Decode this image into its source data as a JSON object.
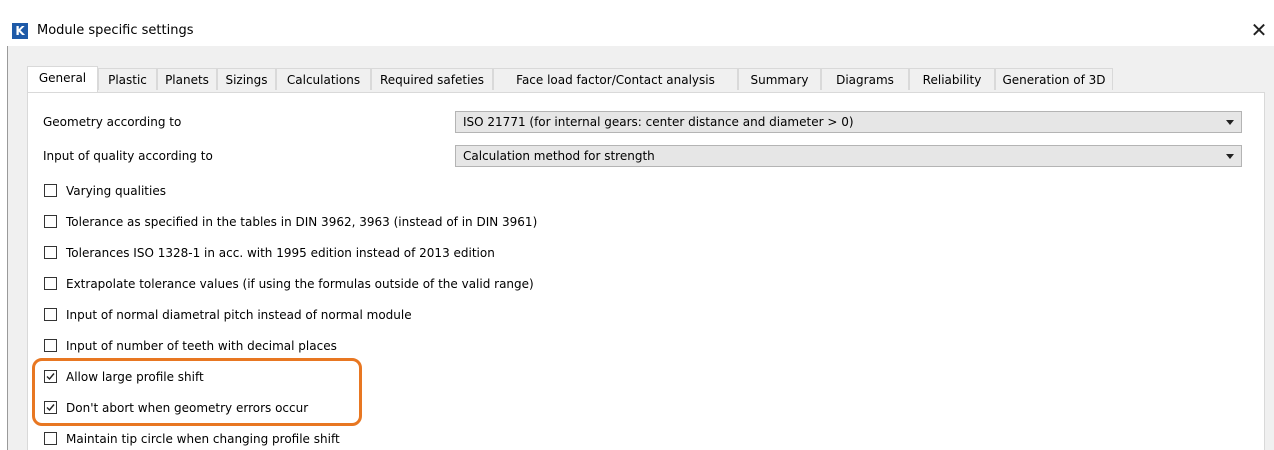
{
  "window": {
    "title": "Module specific settings",
    "app_icon_letter": "K",
    "close_glyph": "✕"
  },
  "tabs": [
    {
      "label": "General",
      "active": true
    },
    {
      "label": "Plastic",
      "active": false
    },
    {
      "label": "Planets",
      "active": false
    },
    {
      "label": "Sizings",
      "active": false
    },
    {
      "label": "Calculations",
      "active": false
    },
    {
      "label": "Required safeties",
      "active": false
    },
    {
      "label": "Face load factor/Contact analysis",
      "active": false
    },
    {
      "label": "Summary",
      "active": false
    },
    {
      "label": "Diagrams",
      "active": false
    },
    {
      "label": "Reliability",
      "active": false
    },
    {
      "label": "Generation of 3D",
      "active": false
    }
  ],
  "settings": {
    "geometry": {
      "label": "Geometry according to",
      "value": "ISO 21771 (for internal gears: center distance and diameter > 0)"
    },
    "quality": {
      "label": "Input of quality according to",
      "value": "Calculation method for strength"
    }
  },
  "checkboxes": [
    {
      "label": "Varying qualities",
      "checked": false
    },
    {
      "label": "Tolerance as specified in the tables in DIN 3962, 3963 (instead of in DIN 3961)",
      "checked": false
    },
    {
      "label": "Tolerances ISO 1328-1 in acc. with 1995 edition instead of 2013 edition",
      "checked": false
    },
    {
      "label": "Extrapolate tolerance values (if using the formulas outside of the valid range)",
      "checked": false
    },
    {
      "label": "Input of normal diametral pitch instead of normal module",
      "checked": false
    },
    {
      "label": "Input of number of teeth with decimal places",
      "checked": false
    },
    {
      "label": "Allow large profile shift",
      "checked": true
    },
    {
      "label": "Don't abort when geometry errors occur",
      "checked": true
    },
    {
      "label": "Maintain tip circle when changing profile shift",
      "checked": false
    }
  ],
  "colors": {
    "highlight": "#e87722",
    "app_icon": "#1e5aa8"
  }
}
